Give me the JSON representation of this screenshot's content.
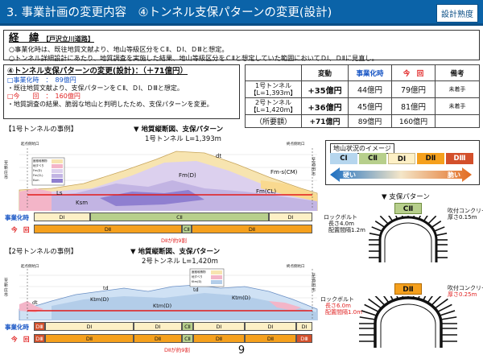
{
  "header": {
    "title": "3. 事業計画の変更内容　④トンネル支保パターンの変更(設計)",
    "badge": "設計熟度"
  },
  "background": {
    "heading": "経　緯",
    "heading_sub": "【戸沢立川道路】",
    "lines": [
      "○事業化時は、既往地質文献より、地山等級区分をＣⅡ、ＤⅠ、ＤⅢと想定。",
      "○トンネル詳細設計にあたり、地質調査を実施した結果、地山等級区分をＣⅡと想定していた範囲においてＤⅠ、ＤⅡに見直し。"
    ]
  },
  "change": {
    "title": "④トンネル支保パターンの変更(設計)：（＋71億円）",
    "at_project_label": "□事業化時　：　89億円",
    "at_project_note": "・既往地質文献より、支保パターンをＣⅡ、ＤⅠ、ＤⅢと想定。",
    "current_label": "□今　　回　：　160億円",
    "current_note": "・地質調査の結果、脆弱な地山と判明したため、支保パターンを変更。"
  },
  "cost_table": {
    "headers": [
      "",
      "変動",
      "事業化時",
      "今　回",
      "備考"
    ],
    "rows": [
      {
        "name": "1号トンネル",
        "sub": "【L=1,393m】",
        "change": "+35億円",
        "at_project": "44億円",
        "current": "79億円",
        "note": "未着手"
      },
      {
        "name": "2号トンネル",
        "sub": "【L=1,420m】",
        "change": "+36億円",
        "at_project": "45億円",
        "current": "81億円",
        "note": "未着手"
      }
    ],
    "total": {
      "name": "（所要額）",
      "change": "+71億円",
      "at_project": "89億円",
      "current": "160億円",
      "note": ""
    }
  },
  "tunnel1": {
    "section_label": "【1号トンネルの事例】",
    "fig_title": "▼ 地質縦断図、支保パターン",
    "fig_sub": "1号トンネル L=1,393m",
    "start_label": "起点側坑口",
    "end_label": "終点側坑口",
    "left_side": "至新庄市",
    "right_side": "至酒田市",
    "bar_label_project": "事業化時",
    "bar_label_current": "今　回",
    "project_segments": [
      "DⅠ",
      "CⅡ",
      "DⅠ"
    ],
    "current_segments": [
      "DⅡ",
      "CⅡ",
      "DⅡ"
    ],
    "note_change": "DⅡが約9割",
    "geo_labels": [
      "dt",
      "Fm(D)",
      "Fm-s(CM)",
      "Ls",
      "Ksm",
      "Fm(CL)"
    ],
    "legend_items": [
      "崖錐堆積物",
      "地すべり",
      "Fm(D)",
      "Fm(CL)",
      "Ksm"
    ]
  },
  "tunnel2": {
    "section_label": "【2号トンネルの事例】",
    "fig_title": "▼ 地質縦断図、支保パターン",
    "fig_sub": "2号トンネル L=1,420m",
    "start_label": "起点側坑口",
    "end_label": "終点側坑口",
    "left_side": "至新庄市",
    "right_side": "至酒田市",
    "bar_label_project": "事業化時",
    "bar_label_current": "今　回",
    "project_segments": [
      "DⅢ",
      "DⅠ",
      "DⅠ",
      "CⅡ",
      "DⅠ",
      "DⅠ",
      "DⅠ"
    ],
    "current_segments": [
      "DⅢ",
      "DⅡ",
      "DⅡ",
      "CⅡ",
      "DⅡ",
      "DⅡ",
      "DⅢ"
    ],
    "note_change": "DⅡが約9割",
    "geo_labels": [
      "td",
      "td",
      "Ktm(D)",
      "Ktm(D)",
      "dt",
      "Ktm(D)"
    ],
    "legend_items": [
      "崖錐堆積物",
      "地すべり",
      "Ktm(D)"
    ]
  },
  "ground_legend": {
    "title": "地山状況のイメージ",
    "classes": [
      "CⅠ",
      "CⅡ",
      "DⅠ",
      "DⅡ",
      "DⅢ"
    ],
    "class_colors": [
      "#b6d6ee",
      "#b7cf8c",
      "#fdf0c6",
      "#f5a01d",
      "#d3502b"
    ],
    "left_word": "硬い",
    "right_word": "脆い"
  },
  "support": {
    "title": "▼ 支保パターン",
    "c2": {
      "badge": "CⅡ",
      "rockbolt": "ロックボルト",
      "length": "長さ4.0m",
      "spacing": "配置間隔1.2m",
      "shotcrete": "吹付コンクリート",
      "thickness": "厚さ0.15m"
    },
    "d2": {
      "badge": "DⅡ",
      "rockbolt": "ロックボルト",
      "length": "長さ6.0m",
      "spacing": "配置間隔1.0m",
      "shotcrete": "吹付コンクリート",
      "thickness": "厚さ0.25m"
    }
  },
  "page_number": "9"
}
